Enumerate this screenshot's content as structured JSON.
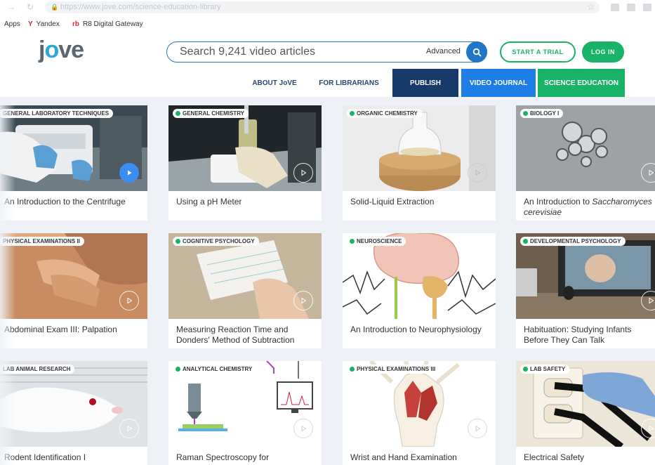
{
  "browser": {
    "url": "https://www.jove.com/science-education-library",
    "bookmarks": [
      {
        "label": "Apps",
        "icon": ""
      },
      {
        "label": "Yandex",
        "icon": "Y"
      },
      {
        "label": "R8 Digital Gateway",
        "icon": "rb"
      }
    ]
  },
  "header": {
    "logo_text": "jove",
    "search_placeholder": "Search 9,241 video articles",
    "advanced_label": "Advanced",
    "trial_label": "START A TRIAL",
    "login_label": "LOG IN"
  },
  "nav": {
    "about": "ABOUT JoVE",
    "librarians": "FOR LIBRARIANS",
    "publish": "PUBLISH",
    "video_journal": "VIDEO JOURNAL",
    "science_education": "SCIENCE EDUCATION"
  },
  "cards": [
    {
      "category": "GENERAL LABORATORY TECHNIQUES",
      "title": "An Introduction to the Centrifuge"
    },
    {
      "category": "GENERAL CHEMISTRY",
      "title": "Using a pH Meter"
    },
    {
      "category": "ORGANIC CHEMISTRY",
      "title": "Solid-Liquid Extraction"
    },
    {
      "category": "BIOLOGY I",
      "title": "An Introduction to ",
      "title_italic": "Saccharomyces cerevisiae"
    },
    {
      "category": "PHYSICAL EXAMINATIONS II",
      "title": "Abdominal Exam III: Palpation"
    },
    {
      "category": "COGNITIVE PSYCHOLOGY",
      "title": "Measuring Reaction Time and Donders' Method of Subtraction"
    },
    {
      "category": "NEUROSCIENCE",
      "title": "An Introduction to Neurophysiology"
    },
    {
      "category": "DEVELOPMENTAL PSYCHOLOGY",
      "title": "Habituation: Studying Infants Before They Can Talk"
    },
    {
      "category": "LAB ANIMAL RESEARCH",
      "title": "Rodent Identification I"
    },
    {
      "category": "ANALYTICAL CHEMISTRY",
      "title": "Raman Spectroscopy for"
    },
    {
      "category": "PHYSICAL EXAMINATIONS III",
      "title": "Wrist and Hand Examination"
    },
    {
      "category": "LAB SAFETY",
      "title": "Electrical Safety"
    }
  ],
  "colors": {
    "brand_green": "#18b366",
    "brand_blue": "#1f7ee6",
    "navy": "#173a6b"
  }
}
